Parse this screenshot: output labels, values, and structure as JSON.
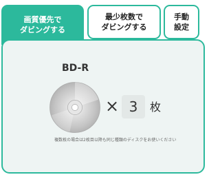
{
  "tabs": [
    {
      "line1": "画質優先で",
      "line2": "ダビングする"
    },
    {
      "line1": "最少枚数で",
      "line2": "ダビングする"
    },
    {
      "line1": "手動",
      "line2": "設定"
    }
  ],
  "disc_type": "BD-R",
  "multiply": "×",
  "quantity": "3",
  "unit": "枚",
  "note": "複数枚の場合は2枚目以降も同じ種類のディスクをお使いください",
  "colors": {
    "accent": "#2cb99c",
    "panel": "#eef4f3"
  },
  "icons": {
    "disc": "disc-icon",
    "times": "multiply-icon"
  }
}
